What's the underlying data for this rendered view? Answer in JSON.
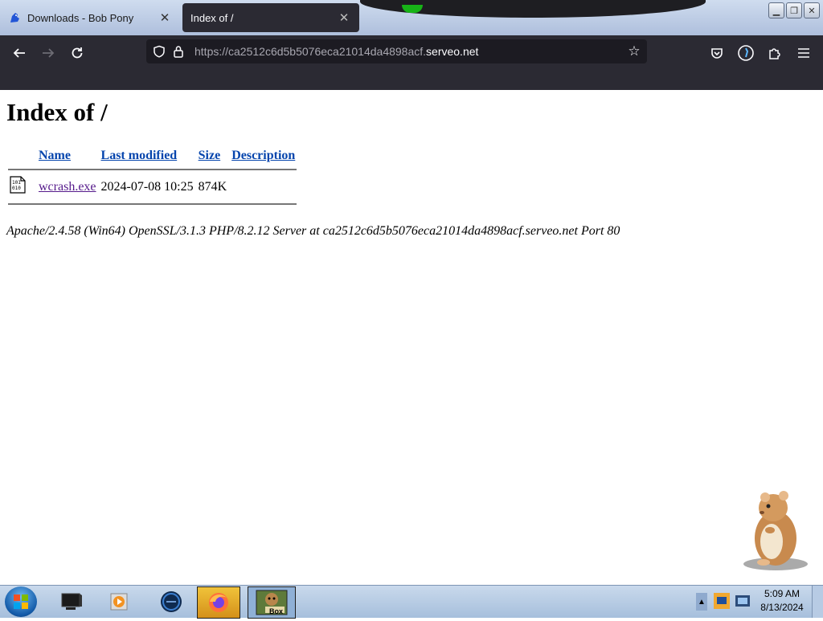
{
  "browser": {
    "tabs": [
      {
        "title": "Downloads - Bob Pony",
        "active": false
      },
      {
        "title": "Index of /",
        "active": true
      }
    ],
    "url": {
      "prefix": "https://ca2512c6d5b5076eca21014da4898acf.",
      "domain": "serveo.net"
    }
  },
  "page": {
    "title": "Index of /",
    "columns": [
      "Name",
      "Last modified",
      "Size",
      "Description"
    ],
    "files": [
      {
        "name": "wcrash.exe",
        "modified": "2024-07-08 10:25",
        "size": "874K",
        "description": ""
      }
    ],
    "footer": "Apache/2.4.58 (Win64) OpenSSL/3.1.3 PHP/8.2.12 Server at ca2512c6d5b5076eca21014da4898acf.serveo.net Port 80"
  },
  "taskbar": {
    "clock_time": "5:09 AM",
    "clock_date": "8/13/2024",
    "pinned": [
      "file-explorer",
      "media-player",
      "browser-globe",
      "firefox",
      "bonzibuddy-box"
    ],
    "box_label": "Box"
  },
  "colors": {
    "browser_dark": "#2b2a33",
    "urlbar": "#1c1b22",
    "link": "#0645ad",
    "visited_link": "#551a8b"
  }
}
